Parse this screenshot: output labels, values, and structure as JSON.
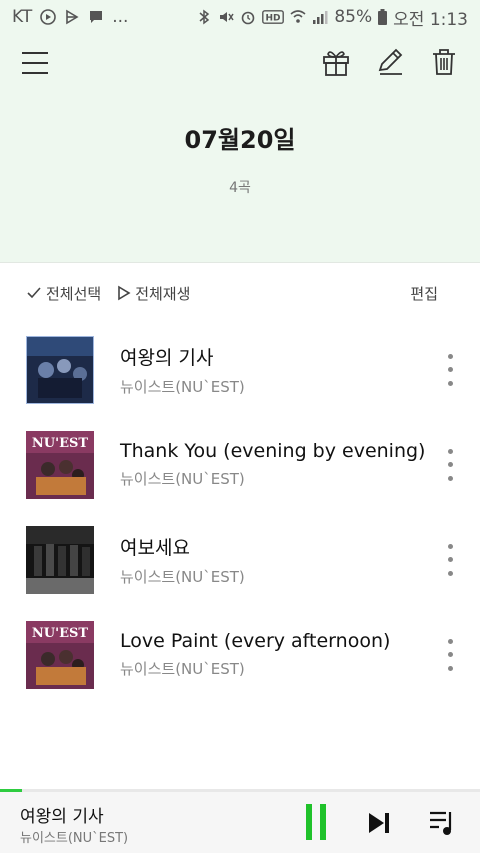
{
  "status_bar": {
    "carrier": "KT",
    "more": "...",
    "battery": "85%",
    "time": "오전 1:13"
  },
  "header": {
    "title": "07월20일",
    "count": "4곡"
  },
  "toolbar": {
    "select_all": "전체선택",
    "play_all": "전체재생",
    "edit": "편집"
  },
  "tracks": [
    {
      "title": "여왕의 기사",
      "artist": "뉴이스트(NU`EST)"
    },
    {
      "title": "Thank You (evening by evening)",
      "artist": "뉴이스트(NU`EST)"
    },
    {
      "title": "여보세요",
      "artist": "뉴이스트(NU`EST)"
    },
    {
      "title": "Love Paint (every afternoon)",
      "artist": "뉴이스트(NU`EST)"
    }
  ],
  "player": {
    "title": "여왕의 기사",
    "artist": "뉴이스트(NU`EST)",
    "progress": 0.045
  },
  "colors": {
    "header_bg": "#eef8ef",
    "accent": "#1fc22a"
  }
}
